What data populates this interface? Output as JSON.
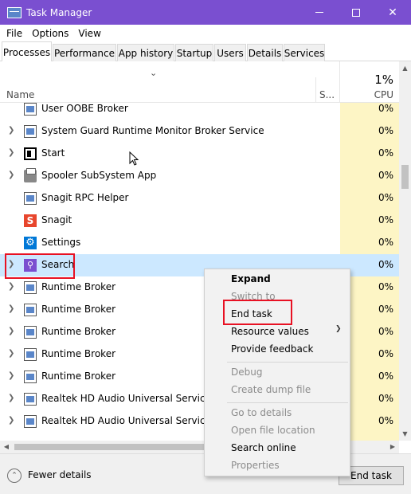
{
  "window": {
    "title": "Task Manager",
    "colors": {
      "titlebar": "#7a4fd0",
      "cpu_column": "#fdf5c5",
      "selected_row": "#cce8ff",
      "highlight": "#e81123"
    }
  },
  "menu": {
    "file": "File",
    "options": "Options",
    "view": "View"
  },
  "tabs": [
    {
      "label": "Processes",
      "active": true
    },
    {
      "label": "Performance"
    },
    {
      "label": "App history"
    },
    {
      "label": "Startup"
    },
    {
      "label": "Users"
    },
    {
      "label": "Details"
    },
    {
      "label": "Services"
    }
  ],
  "columns": {
    "name": "Name",
    "status": "S...",
    "cpu_total": "1%",
    "cpu": "CPU"
  },
  "rows": [
    {
      "name": "User OOBE Broker",
      "cpu": "0%",
      "icon": "window-icon",
      "expand": false
    },
    {
      "name": "System Guard Runtime Monitor Broker Service",
      "cpu": "0%",
      "icon": "window-icon",
      "expand": true
    },
    {
      "name": "Start",
      "cpu": "0%",
      "icon": "start-icon",
      "expand": true
    },
    {
      "name": "Spooler SubSystem App",
      "cpu": "0%",
      "icon": "printer-icon",
      "expand": true
    },
    {
      "name": "Snagit RPC Helper",
      "cpu": "0%",
      "icon": "window-icon",
      "expand": false
    },
    {
      "name": "Snagit",
      "cpu": "0%",
      "icon": "snagit-icon",
      "expand": false
    },
    {
      "name": "Settings",
      "cpu": "0%",
      "icon": "settings-icon",
      "expand": false
    },
    {
      "name": "Search",
      "cpu": "0%",
      "icon": "search-icon",
      "expand": true,
      "selected": true
    },
    {
      "name": "Runtime Broker",
      "cpu": "0%",
      "icon": "window-icon",
      "expand": true
    },
    {
      "name": "Runtime Broker",
      "cpu": "0%",
      "icon": "window-icon",
      "expand": true
    },
    {
      "name": "Runtime Broker",
      "cpu": "0%",
      "icon": "window-icon",
      "expand": true
    },
    {
      "name": "Runtime Broker",
      "cpu": "0%",
      "icon": "window-icon",
      "expand": true
    },
    {
      "name": "Runtime Broker",
      "cpu": "0%",
      "icon": "window-icon",
      "expand": true
    },
    {
      "name": "Realtek HD Audio Universal Service",
      "cpu": "0%",
      "icon": "window-icon",
      "expand": true
    },
    {
      "name": "Realtek HD Audio Universal Service",
      "cpu": "0%",
      "icon": "window-icon",
      "expand": true
    }
  ],
  "context_menu": {
    "expand": "Expand",
    "switch_to": "Switch to",
    "end_task": "End task",
    "resource_values": "Resource values",
    "provide_feedback": "Provide feedback",
    "debug": "Debug",
    "create_dump_file": "Create dump file",
    "go_to_details": "Go to details",
    "open_file_location": "Open file location",
    "search_online": "Search online",
    "properties": "Properties"
  },
  "footer": {
    "fewer_details": "Fewer details",
    "end_task": "End task"
  }
}
